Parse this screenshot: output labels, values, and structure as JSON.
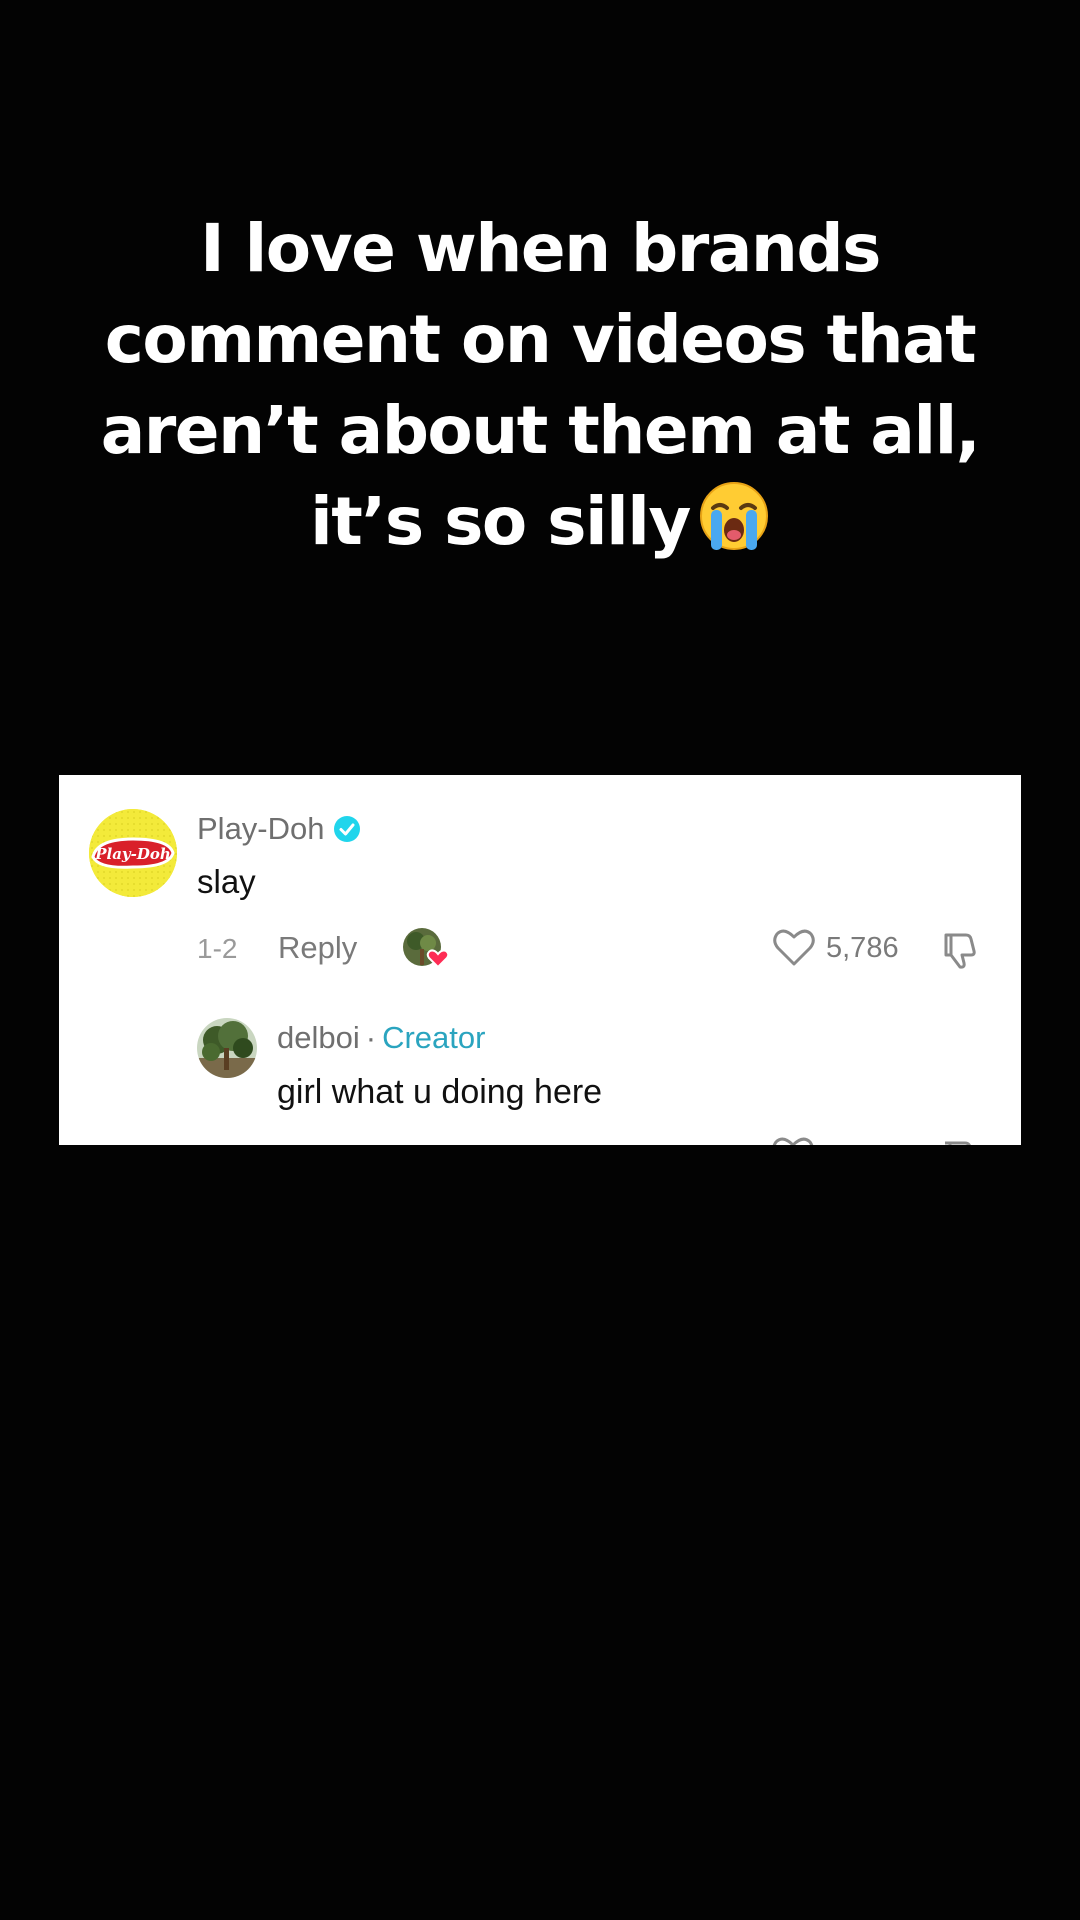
{
  "caption": {
    "line1": "I love when brands",
    "line2": "comment on videos that",
    "line3": "aren’t about them  at all,",
    "line4": "it’s so silly"
  },
  "emoji_icon": "loudly-crying-face-emoji",
  "comment": {
    "avatar_icon": "play-doh-logo",
    "avatar_logo_text": "Play-Doh",
    "username": "Play-Doh",
    "verified_icon": "verified-badge-icon",
    "text": "slay",
    "date": "1-2",
    "reply_label": "Reply",
    "creator_liked_icon": "creator-liked-heart-icon",
    "like_icon": "heart-outline-icon",
    "like_count": "5,786",
    "dislike_icon": "thumbs-down-icon"
  },
  "reply": {
    "avatar_icon": "tree-avatar",
    "username": "delboi",
    "separator": "·",
    "badge": "Creator",
    "text": "girl what u doing here"
  },
  "colors": {
    "background": "#030303",
    "card": "#ffffff",
    "verified": "#20d5ec",
    "creator_badge": "#2aa4bf",
    "heart_red": "#fe2c55",
    "playdoh_yellow": "#f3ea3a",
    "playdoh_red": "#d9202a"
  }
}
